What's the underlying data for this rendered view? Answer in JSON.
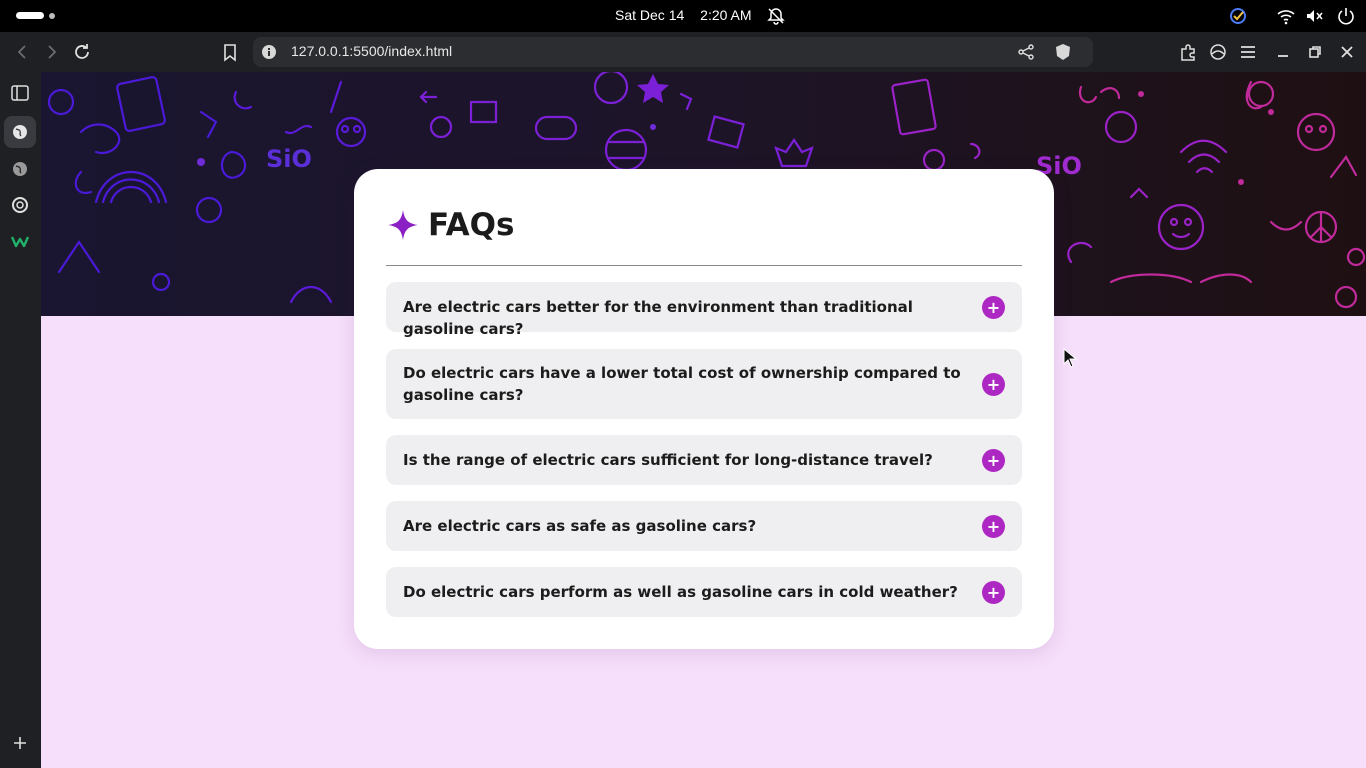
{
  "os": {
    "date": "Sat Dec 14",
    "time": "2:20 AM"
  },
  "browser": {
    "url": "127.0.0.1:5500/index.html"
  },
  "page": {
    "title": "FAQs",
    "accent": "#ad28c3",
    "faqs": [
      "Are electric cars better for the environment than traditional gasoline cars?",
      "Do electric cars have a lower total cost of ownership compared to gasoline cars?",
      "Is the range of electric cars sufficient for long-distance travel?",
      "Are electric cars as safe as gasoline cars?",
      "Do electric cars perform as well as gasoline cars in cold weather?"
    ],
    "toggle_symbol": "+"
  }
}
